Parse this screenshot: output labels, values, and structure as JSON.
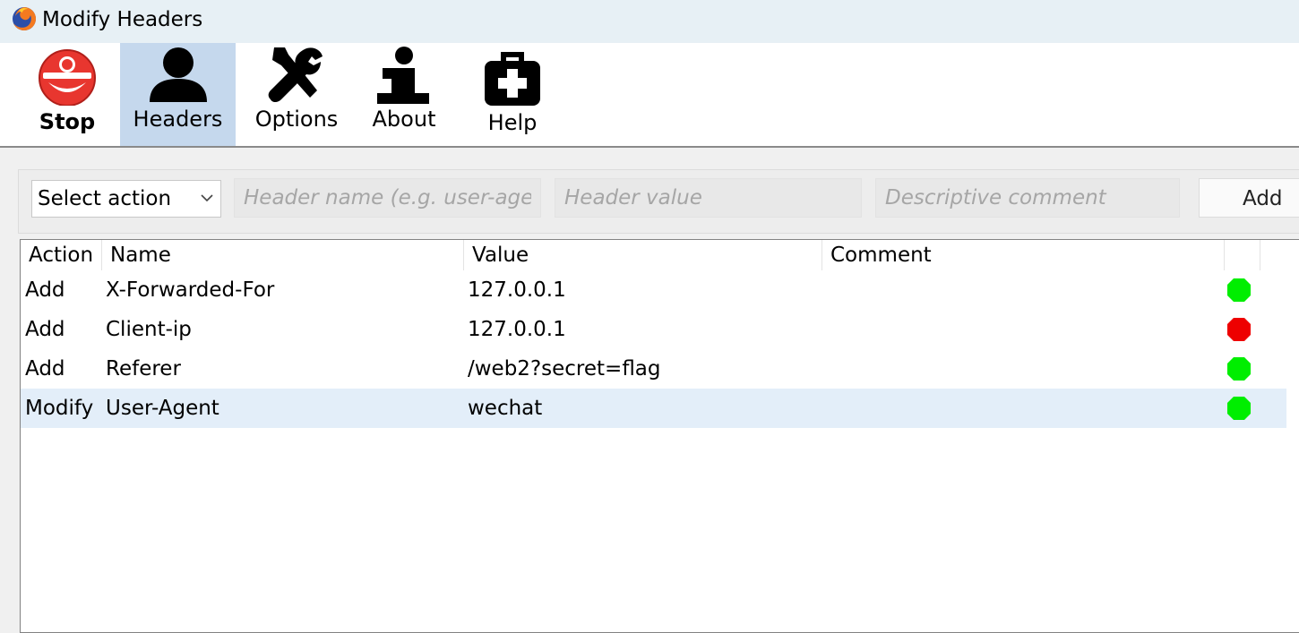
{
  "window": {
    "title": "Modify Headers"
  },
  "toolbar": {
    "buttons": [
      {
        "label": "Stop"
      },
      {
        "label": "Headers"
      },
      {
        "label": "Options"
      },
      {
        "label": "About"
      },
      {
        "label": "Help"
      }
    ]
  },
  "form": {
    "action_select": {
      "value": "Select action"
    },
    "header_name": {
      "placeholder": "Header name (e.g. user-agent)"
    },
    "header_value": {
      "placeholder": "Header value"
    },
    "comment": {
      "placeholder": "Descriptive comment"
    },
    "add_label": "Add"
  },
  "table": {
    "columns": [
      "Action",
      "Name",
      "Value",
      "Comment"
    ],
    "rows": [
      {
        "action": "Add",
        "name": "X-Forwarded-For",
        "value": "127.0.0.1",
        "comment": "",
        "enabled": true
      },
      {
        "action": "Add",
        "name": "Client-ip",
        "value": "127.0.0.1",
        "comment": "",
        "enabled": false
      },
      {
        "action": "Add",
        "name": "Referer",
        "value": "/web2?secret=flag",
        "comment": "",
        "enabled": true
      },
      {
        "action": "Modify",
        "name": "User-Agent",
        "value": "wechat",
        "comment": "",
        "enabled": true
      }
    ]
  },
  "colors": {
    "enabled": "#00ee00",
    "disabled": "#ee0000",
    "selected_row": "#e3eef9",
    "active_tab": "#c5d8ed"
  }
}
